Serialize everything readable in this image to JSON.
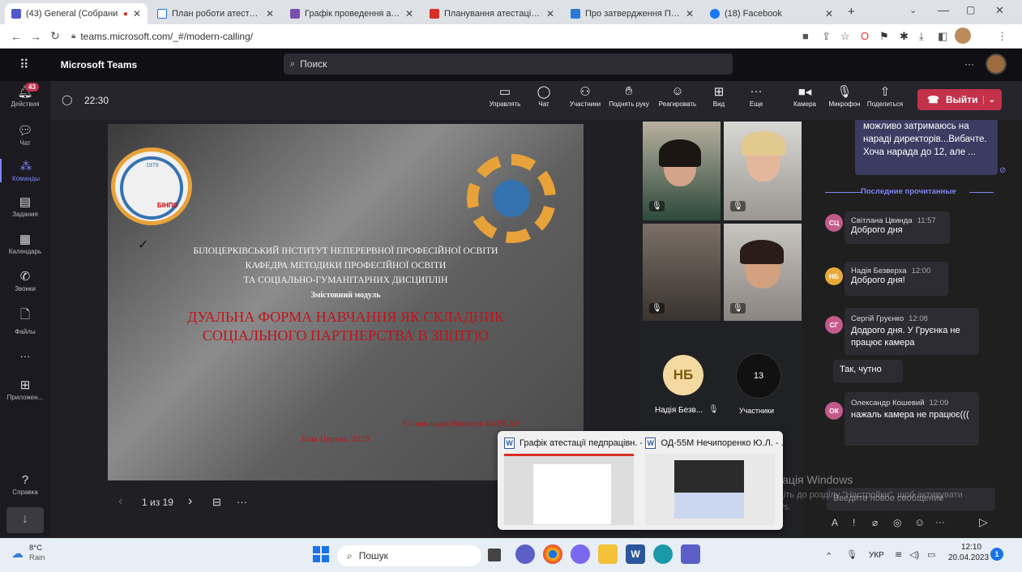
{
  "browser": {
    "tabs": [
      {
        "title": "(43) General (Собрани",
        "color": "#5059c9"
      },
      {
        "title": "План роботи атестаційної",
        "color": "#ffffff"
      },
      {
        "title": "Графік проведення атестаі",
        "color": "#7a4fb0"
      },
      {
        "title": "Планування атестації педа",
        "color": "#d93025"
      },
      {
        "title": "Про затвердження Полож",
        "color": "#2b7bd6"
      },
      {
        "title": "(18) Facebook",
        "color": "#1877f2"
      }
    ],
    "url": "teams.microsoft.com/_#/modern-calling/"
  },
  "teams": {
    "app_name": "Microsoft Teams",
    "search_placeholder": "Поиск",
    "more": "···",
    "rail": [
      {
        "label": "Действия",
        "badge": "43"
      },
      {
        "label": "Чат"
      },
      {
        "label": "Команды"
      },
      {
        "label": "Задания"
      },
      {
        "label": "Календарь"
      },
      {
        "label": "Звонки"
      },
      {
        "label": "Файлы"
      },
      {
        "label": "···"
      },
      {
        "label": "Приложен..."
      },
      {
        "label": "Справка"
      }
    ],
    "timer": "22:30",
    "controls": [
      "Управлять",
      "Чат",
      "Участники",
      "Поднять руку",
      "Реагировать",
      "Вид",
      "Еще",
      "Камера",
      "Микрофон",
      "Поделиться"
    ],
    "leave": "Выйти"
  },
  "slide": {
    "line1": "БІЛОЦЕРКІВСЬКИЙ ІНСТИТУТ НЕПЕРЕРВНОЇ ПРОФЕСІЙНОЇ ОСВІТИ",
    "line2": "КАФЕДРА МЕТОДИКИ ПРОФЕСІЙНОЇ ОСВІТИ",
    "line3": "ТА СОЦІАЛЬНО-ГУМАНІТАРНИХ ДИСЦИПЛІН",
    "line4": "Змістовний модуль",
    "title1": "ДУАЛЬНА ФОРМА НАВЧАННЯ ЯК СКЛАДНИК",
    "title2": "СОЦІАЛЬНОГО ПАРТНЕРСТВА В ЗП(ПТ)О",
    "author": "Ст.викладач Вікторія БАРКАР",
    "city": "Біла Церква, 2023",
    "logo_text": "БІНПО",
    "logo_year": "1979",
    "checkmark": "✓",
    "pager": "1 из 19"
  },
  "participants": {
    "initials": "НБ",
    "name": "Надія Безв...",
    "count": "13",
    "count_label": "Участники"
  },
  "chat": {
    "top_message": "можливо затримаюсь на нараді директорів...Вибачте. Хоча нарада до 12, але ...",
    "divider": "Последние прочитанные",
    "messages": [
      {
        "initials": "СЦ",
        "name": "Світлана Цвинда",
        "time": "11:57",
        "text": "Доброго дня",
        "color": "#c35a8a"
      },
      {
        "initials": "НБ",
        "name": "Надія Безверха",
        "time": "12:00",
        "text": "Доброго дня!",
        "color": "#e8a93a"
      },
      {
        "initials": "СГ",
        "name": "Сергій Груєнко",
        "time": "12:08",
        "text": "Додрого дня. У Груєнка не працює камера",
        "color": "#c35a8a"
      },
      {
        "initials": "",
        "name": "",
        "time": "",
        "text": "Так, чутно",
        "color": ""
      },
      {
        "initials": "ОК",
        "name": "Олександр Кошевий",
        "time": "12:09",
        "text": "нажаль камера не працює(((",
        "color": "#c35a8a"
      }
    ],
    "input_placeholder": "Введите новое сообщение"
  },
  "popup": {
    "items": [
      "Графік атестації педпрацівн. - ...",
      "ОД-55М Нечипоренко Ю.Л. - ..."
    ]
  },
  "watermark": {
    "line1": "Активація Windows",
    "line2": "Перейдіть до розділу \"Настройки\", щоб активувати Windows."
  },
  "taskbar": {
    "weather_temp": "8°C",
    "weather_desc": "Rain",
    "search": "Пошук",
    "lang": "УКР",
    "time": "12:10",
    "date": "20.04.2023",
    "notif": "1"
  }
}
